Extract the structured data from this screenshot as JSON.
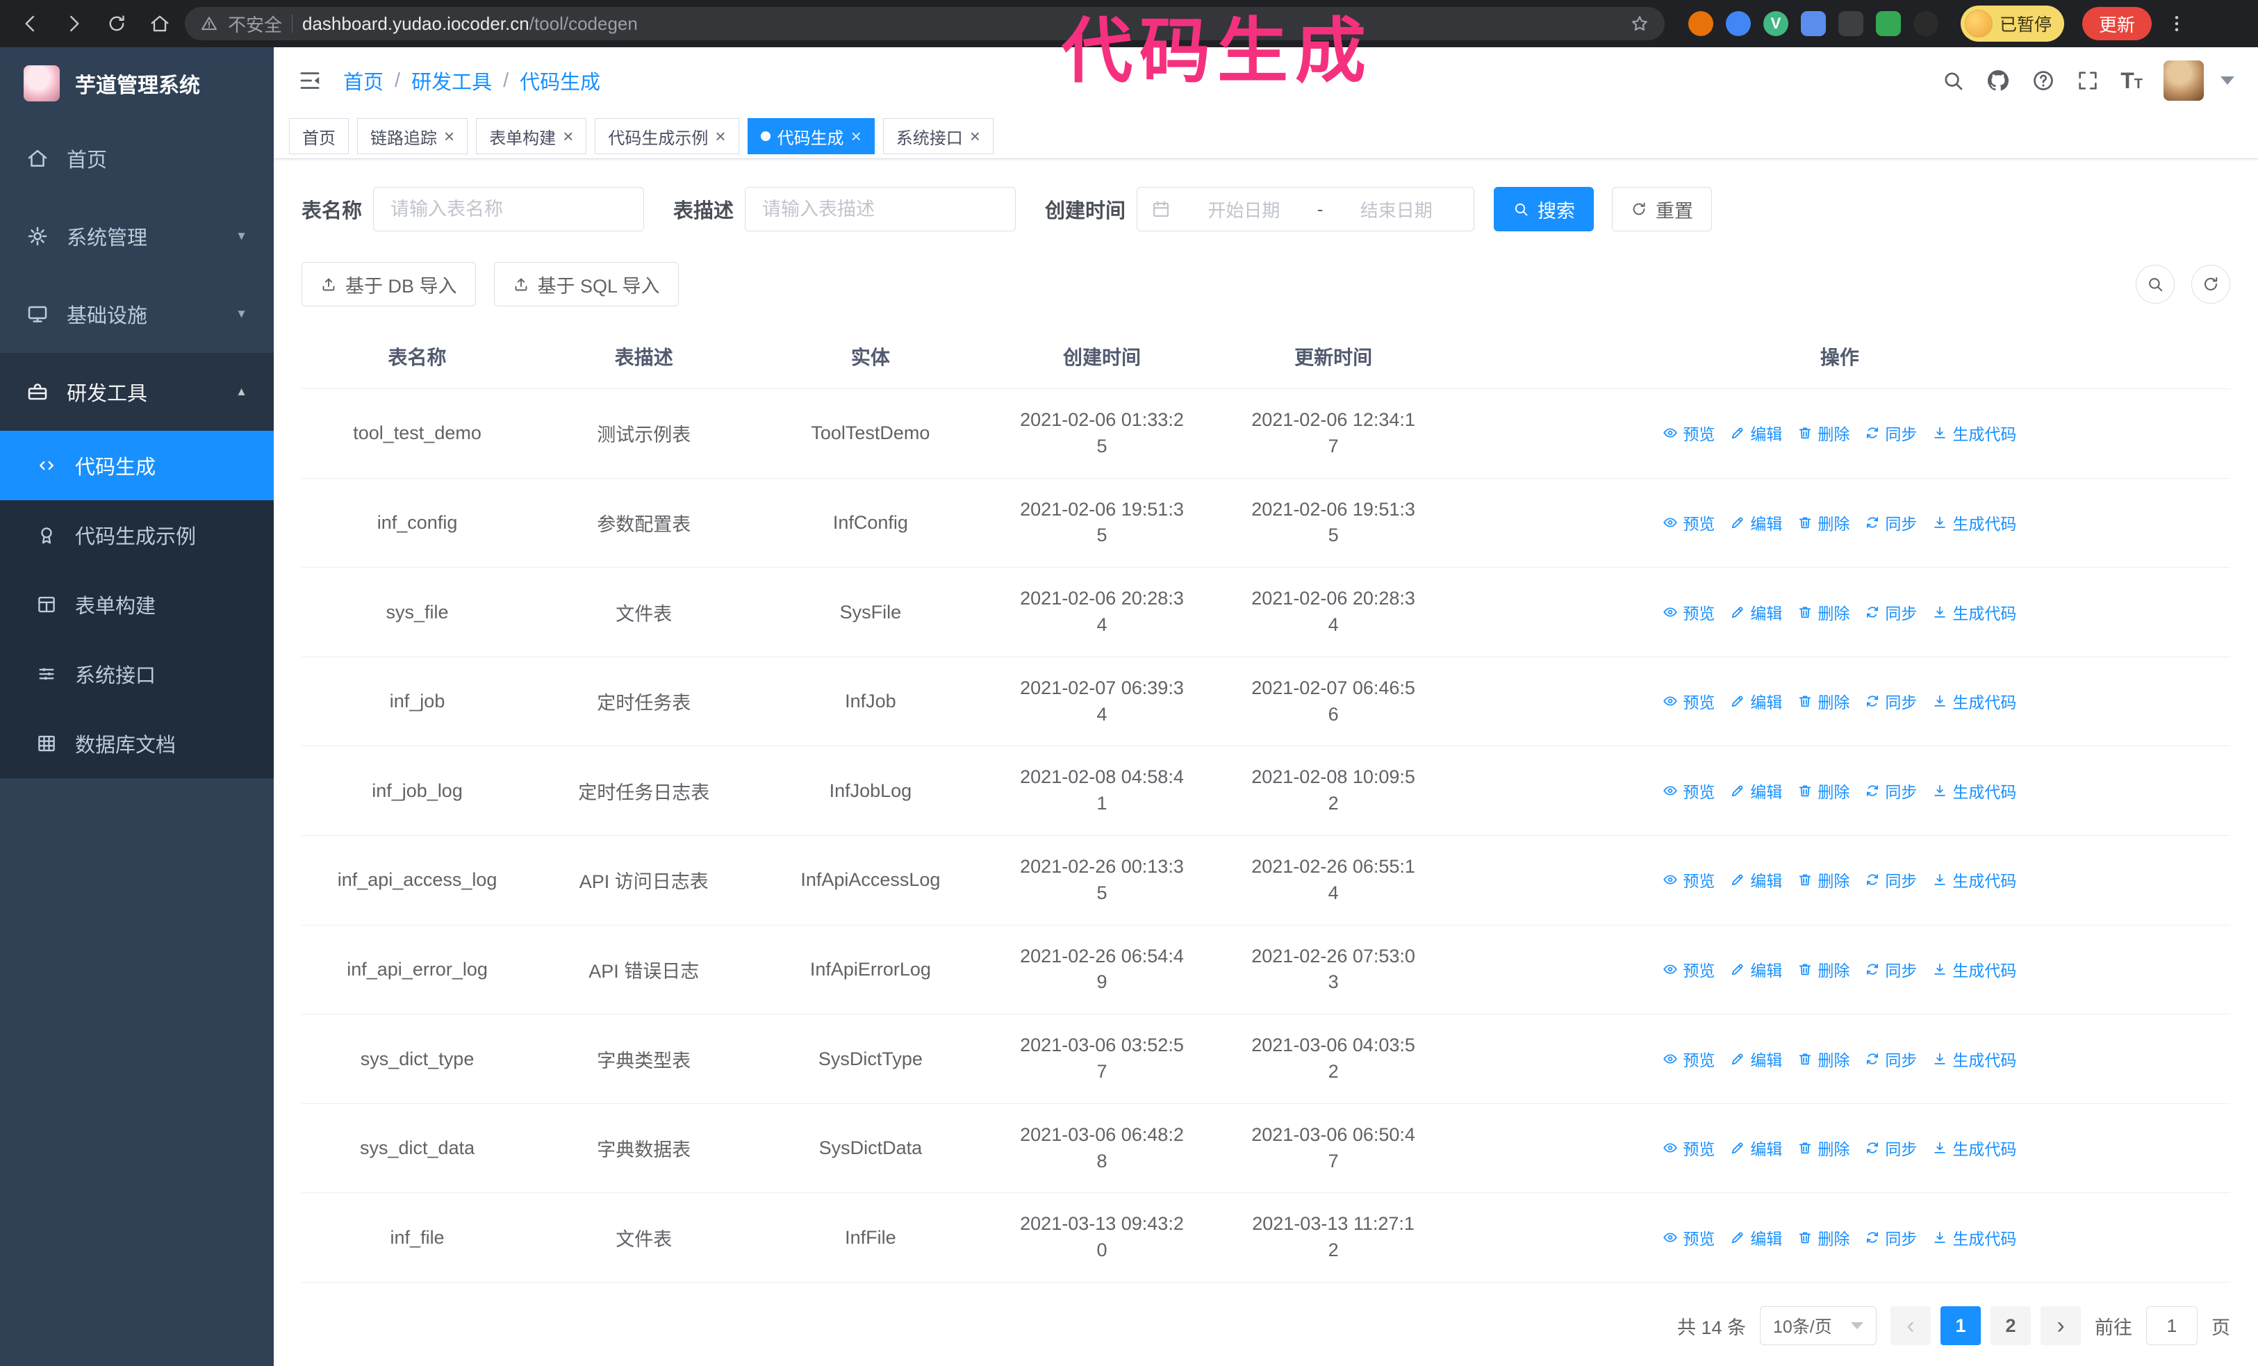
{
  "theme": {
    "primary": "#1890ff",
    "annotation": "#f5317f",
    "sidebar_bg": "#304156",
    "submenu_bg": "#1f2d3d",
    "chrome_bg": "#202124",
    "addr_bg": "#35363a",
    "update_red": "#e8453c",
    "paused_bg": "#f6d96b"
  },
  "browser": {
    "security_label": "不安全",
    "url_host": "dashboard.yudao.iocoder.cn",
    "url_path": "/tool/codegen",
    "paused_badge": "已暂停",
    "update_button": "更新",
    "extensions": [
      {
        "color": "#e8710a",
        "glyph": "",
        "shape": "round"
      },
      {
        "color": "#4285f4",
        "glyph": "",
        "shape": "round"
      },
      {
        "color": "#41b883",
        "glyph": "V",
        "shape": "round"
      },
      {
        "color": "#5b8def",
        "glyph": "",
        "shape": "square"
      },
      {
        "color": "#3d4043",
        "glyph": "",
        "shape": "square"
      },
      {
        "color": "#34a853",
        "glyph": "",
        "shape": "square"
      },
      {
        "color": "#2b2b2b",
        "glyph": "",
        "shape": "round"
      }
    ]
  },
  "annotation": {
    "text": "代码生成"
  },
  "sidebar": {
    "logo_title": "芋道管理系统",
    "items": [
      {
        "label": "首页",
        "icon": "home"
      },
      {
        "label": "系统管理",
        "icon": "gear",
        "chevron": "down"
      },
      {
        "label": "基础设施",
        "icon": "monitor",
        "chevron": "down"
      },
      {
        "label": "研发工具",
        "icon": "toolbox",
        "chevron": "up",
        "expanded": true
      }
    ],
    "subitems": [
      {
        "label": "代码生成",
        "icon": "code",
        "active": true
      },
      {
        "label": "代码生成示例",
        "icon": "badge"
      },
      {
        "label": "表单构建",
        "icon": "form-grid"
      },
      {
        "label": "系统接口",
        "icon": "list-sliders"
      },
      {
        "label": "数据库文档",
        "icon": "table-grid"
      }
    ]
  },
  "header": {
    "breadcrumb": [
      "首页",
      "研发工具",
      "代码生成"
    ]
  },
  "tabs": [
    {
      "label": "首页",
      "closable": false,
      "active": false
    },
    {
      "label": "链路追踪",
      "closable": true,
      "active": false
    },
    {
      "label": "表单构建",
      "closable": true,
      "active": false
    },
    {
      "label": "代码生成示例",
      "closable": true,
      "active": false
    },
    {
      "label": "代码生成",
      "closable": true,
      "active": true
    },
    {
      "label": "系统接口",
      "closable": true,
      "active": false
    }
  ],
  "filters": {
    "table_name_label": "表名称",
    "table_name_placeholder": "请输入表名称",
    "table_desc_label": "表描述",
    "table_desc_placeholder": "请输入表描述",
    "create_time_label": "创建时间",
    "date_start_placeholder": "开始日期",
    "date_separator": "-",
    "date_end_placeholder": "结束日期",
    "search_button": "搜索",
    "reset_button": "重置"
  },
  "toolbar": {
    "import_db_button": "基于 DB 导入",
    "import_sql_button": "基于 SQL 导入"
  },
  "table": {
    "columns": [
      "表名称",
      "表描述",
      "实体",
      "创建时间",
      "更新时间",
      "操作"
    ],
    "actions": [
      "预览",
      "编辑",
      "删除",
      "同步",
      "生成代码"
    ],
    "rows": [
      {
        "name": "tool_test_demo",
        "desc": "测试示例表",
        "entity": "ToolTestDemo",
        "created": "2021-02-06 01:33:25",
        "updated": "2021-02-06 12:34:17"
      },
      {
        "name": "inf_config",
        "desc": "参数配置表",
        "entity": "InfConfig",
        "created": "2021-02-06 19:51:35",
        "updated": "2021-02-06 19:51:35"
      },
      {
        "name": "sys_file",
        "desc": "文件表",
        "entity": "SysFile",
        "created": "2021-02-06 20:28:34",
        "updated": "2021-02-06 20:28:34"
      },
      {
        "name": "inf_job",
        "desc": "定时任务表",
        "entity": "InfJob",
        "created": "2021-02-07 06:39:34",
        "updated": "2021-02-07 06:46:56"
      },
      {
        "name": "inf_job_log",
        "desc": "定时任务日志表",
        "entity": "InfJobLog",
        "created": "2021-02-08 04:58:41",
        "updated": "2021-02-08 10:09:52"
      },
      {
        "name": "inf_api_access_log",
        "desc": "API 访问日志表",
        "entity": "InfApiAccessLog",
        "created": "2021-02-26 00:13:35",
        "updated": "2021-02-26 06:55:14"
      },
      {
        "name": "inf_api_error_log",
        "desc": "API 错误日志",
        "entity": "InfApiErrorLog",
        "created": "2021-02-26 06:54:49",
        "updated": "2021-02-26 07:53:03"
      },
      {
        "name": "sys_dict_type",
        "desc": "字典类型表",
        "entity": "SysDictType",
        "created": "2021-03-06 03:52:57",
        "updated": "2021-03-06 04:03:52"
      },
      {
        "name": "sys_dict_data",
        "desc": "字典数据表",
        "entity": "SysDictData",
        "created": "2021-03-06 06:48:28",
        "updated": "2021-03-06 06:50:47"
      },
      {
        "name": "inf_file",
        "desc": "文件表",
        "entity": "InfFile",
        "created": "2021-03-13 09:43:20",
        "updated": "2021-03-13 11:27:12"
      }
    ]
  },
  "pagination": {
    "total_text": "共 14 条",
    "page_size": "10条/页",
    "pages": [
      "1",
      "2"
    ],
    "active_page": "1",
    "goto_prefix": "前往",
    "goto_value": "1",
    "goto_suffix": "页"
  }
}
